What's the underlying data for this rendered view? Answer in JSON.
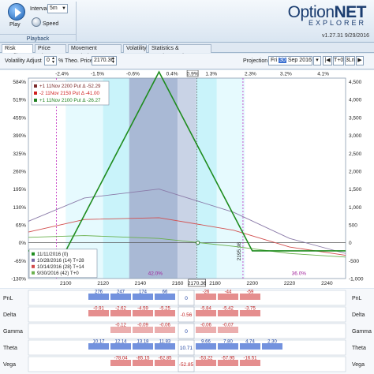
{
  "toolbar": {
    "play_label": "Play",
    "interval_label": "Interval",
    "interval_value": "5m",
    "speed_label": "Speed",
    "group_label": "Playback"
  },
  "logo": {
    "main_a": "Option",
    "main_b": "NET",
    "sub": "EXPLORER"
  },
  "version": "v1.27.31   9/29/2016",
  "tabs": [
    "Risk Profile",
    "Price Chart",
    "Movement Analysis",
    "Volatility",
    "Statistics & Fundamentals"
  ],
  "controls": {
    "vol_adjust_label": "Volatility Adjust",
    "vol_adjust_value": "0",
    "vol_adjust_unit": "%",
    "theo_price_label": "Theo. Price",
    "theo_price_value": "2170.36",
    "projection_label": "Projection",
    "projection_day": "Fri",
    "projection_date": "30",
    "projection_month": "Sep",
    "projection_year": "2016",
    "t0_btn": "T+0",
    "t3ln_btn": "3Ln"
  },
  "legend_positions": [
    {
      "text": "+1 11Nov 2200 Put Δ   -52.29",
      "color": "#7a2a2a"
    },
    {
      "text": "-2 11Nov 2150 Put Δ   -41.00",
      "color": "#d02020"
    },
    {
      "text": "+1 11Nov 2100 Put Δ   -26.27",
      "color": "#208020"
    }
  ],
  "legend_dates": [
    {
      "text": "11/11/2016 (0)",
      "color": "#1e8c1e"
    },
    {
      "text": "10/28/2016 (14)  T+28",
      "color": "#7a6aa5"
    },
    {
      "text": "10/14/2016 (28)  T+14",
      "color": "#d24a4a"
    },
    {
      "text": "9/30/2016 (42)  T+0",
      "color": "#6ab04c"
    }
  ],
  "chart_data": {
    "type": "line",
    "xlabel": "",
    "ylabel_left": "",
    "ylabel_right": "",
    "x_ticks": [
      "2100",
      "2120",
      "2140",
      "2160",
      "2170.36",
      "2180",
      "2200",
      "2220",
      "2240"
    ],
    "x_range": [
      2080,
      2250
    ],
    "top_pct_ticks": [
      "-2.4%",
      "-1.5%",
      "-0.6%",
      "0.4%",
      "0.9%",
      "1.3%",
      "2.3%",
      "3.2%",
      "4.1%"
    ],
    "left_pct_ticks": [
      "584%",
      "519%",
      "455%",
      "390%",
      "325%",
      "260%",
      "195%",
      "130%",
      "65%",
      "0%",
      "-65%",
      "-130%"
    ],
    "right_ticks": [
      "4,500",
      "4,000",
      "3,500",
      "3,000",
      "2,500",
      "2,000",
      "1,500",
      "1,000",
      "500",
      "0",
      "-500",
      "-1,000"
    ],
    "y_range": [
      -1000,
      4600
    ],
    "expiry_payoff": {
      "x": [
        2080,
        2100,
        2150,
        2200,
        2250
      ],
      "y": [
        -227,
        -227,
        4773,
        -227,
        -227
      ]
    },
    "curves": [
      {
        "name": "10/28/2016 (14)  T+28",
        "x": [
          2080,
          2110,
          2150,
          2190,
          2220,
          2250
        ],
        "y": [
          600,
          1250,
          1500,
          850,
          120,
          -300
        ]
      },
      {
        "name": "10/14/2016 (28)  T+14",
        "x": [
          2080,
          2110,
          2150,
          2190,
          2220,
          2250
        ],
        "y": [
          300,
          650,
          700,
          350,
          -120,
          -350
        ]
      },
      {
        "name": "9/30/2016 (42)  T+0",
        "x": [
          2080,
          2110,
          2150,
          2190,
          2220,
          2250
        ],
        "y": [
          150,
          200,
          120,
          -100,
          -300,
          -400
        ]
      }
    ],
    "breakevens": [
      2095,
      2195
    ],
    "breakeven_label": "2195.98",
    "current_price": 2170.36,
    "zone_labels": [
      "42.0%",
      "36.0%"
    ]
  },
  "greeks": {
    "rows": [
      "PnL",
      "Delta",
      "Gamma",
      "Theta",
      "Vega"
    ],
    "center": [
      "0",
      "-0.56",
      "0",
      "10.71",
      "-52.85"
    ],
    "pnl_left": [
      "276",
      "247",
      "174",
      "66"
    ],
    "pnl_right": [
      "-26",
      "-44",
      "-59"
    ],
    "delta_left": [
      "-0.91",
      "-2.62",
      "-4.59",
      "-5.25"
    ],
    "delta_right": [
      "-5.84",
      "-5.42",
      "-3.75"
    ],
    "gamma_left": [
      "-0.12",
      "-0.09",
      "-0.06"
    ],
    "gamma_right": [
      "-0.06",
      "-0.07"
    ],
    "theta_left": [
      "10.17",
      "12.14",
      "13.18",
      "11.83"
    ],
    "theta_right": [
      "9.66",
      "7.80",
      "4.74",
      "2.30"
    ],
    "vega_left": [
      "-78.04",
      "-85.15",
      "-62.85"
    ],
    "vega_right": [
      "-53.22",
      "-57.95",
      "-16.51"
    ]
  }
}
